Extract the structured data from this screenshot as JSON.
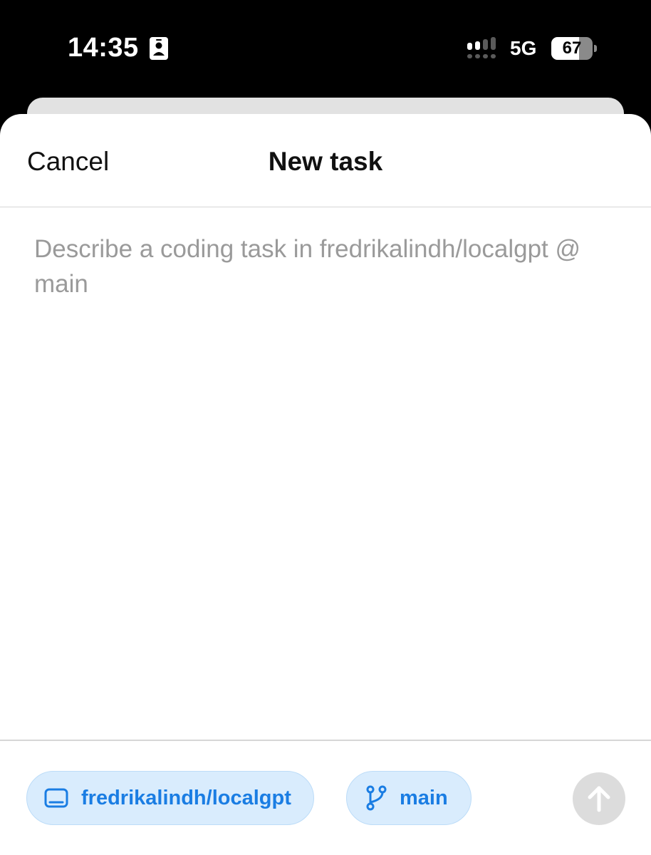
{
  "status_bar": {
    "time": "14:35",
    "network": "5G",
    "battery_level": "67",
    "battery_fraction": 0.67,
    "icons": [
      "id-card-icon",
      "cellular-signal-icon",
      "battery-icon"
    ]
  },
  "sheet": {
    "title": "New task",
    "cancel_label": "Cancel"
  },
  "composer": {
    "placeholder": "Describe a coding task in fredrikalindh/localgpt @ main",
    "value": ""
  },
  "toolbar": {
    "repo_label": "fredrikalindh/localgpt",
    "repo_icon": "monitor-icon",
    "branch_label": "main",
    "branch_icon": "git-branch-icon",
    "send_icon": "arrow-up-icon"
  },
  "colors": {
    "accent": "#1a7de3",
    "chip_background": "#d9ecfd",
    "send_disabled": "#dcdcdc"
  }
}
